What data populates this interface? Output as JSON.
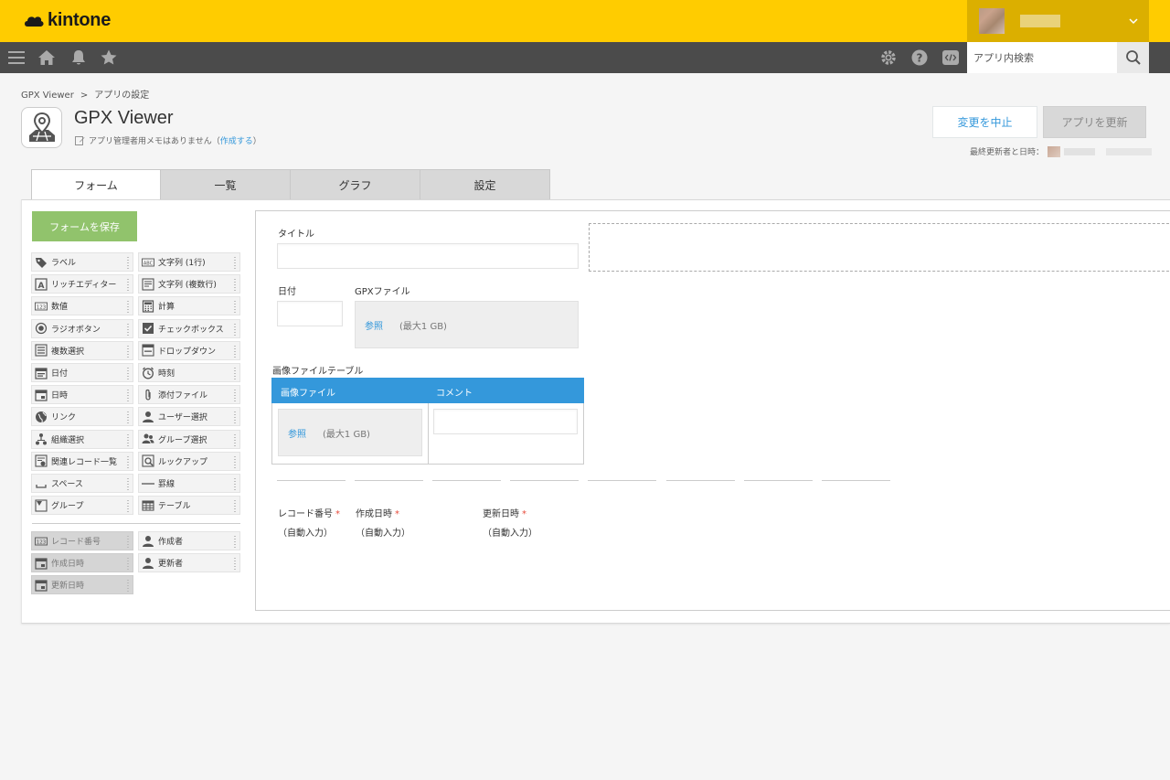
{
  "header": {
    "brand": "kintone",
    "search_placeholder": "アプリ内検索"
  },
  "breadcrumb": {
    "items": [
      "GPX Viewer",
      "アプリの設定"
    ],
    "separator": ">"
  },
  "app": {
    "title": "GPX Viewer",
    "memo_text": "アプリ管理者用メモはありません",
    "memo_paren_open": "（",
    "memo_link": "作成する",
    "memo_paren_close": "）"
  },
  "actions": {
    "cancel_label": "変更を中止",
    "update_label": "アプリを更新",
    "last_updated_label": "最終更新者と日時："
  },
  "tabs": [
    "フォーム",
    "一覧",
    "グラフ",
    "設定"
  ],
  "palette": {
    "save_label": "フォームを保存",
    "left": [
      {
        "label": "ラベル",
        "icon": "tag-icon"
      },
      {
        "label": "リッチエディター",
        "icon": "rich-editor-icon"
      },
      {
        "label": "数値",
        "icon": "number-icon"
      },
      {
        "label": "ラジオボタン",
        "icon": "radio-icon"
      },
      {
        "label": "複数選択",
        "icon": "multi-select-icon"
      },
      {
        "label": "日付",
        "icon": "calendar-icon"
      },
      {
        "label": "日時",
        "icon": "datetime-icon"
      },
      {
        "label": "リンク",
        "icon": "globe-icon"
      },
      {
        "label": "組織選択",
        "icon": "org-icon"
      },
      {
        "label": "関連レコード一覧",
        "icon": "related-records-icon"
      },
      {
        "label": "スペース",
        "icon": "space-icon"
      },
      {
        "label": "グループ",
        "icon": "group-icon"
      }
    ],
    "right": [
      {
        "label": "文字列 (1行)",
        "icon": "text-single-icon"
      },
      {
        "label": "文字列 (複数行)",
        "icon": "text-multi-icon"
      },
      {
        "label": "計算",
        "icon": "calculator-icon"
      },
      {
        "label": "チェックボックス",
        "icon": "checkbox-icon"
      },
      {
        "label": "ドロップダウン",
        "icon": "dropdown-icon"
      },
      {
        "label": "時刻",
        "icon": "clock-icon"
      },
      {
        "label": "添付ファイル",
        "icon": "paperclip-icon"
      },
      {
        "label": "ユーザー選択",
        "icon": "user-icon"
      },
      {
        "label": "グループ選択",
        "icon": "users-icon"
      },
      {
        "label": "ルックアップ",
        "icon": "lookup-icon"
      },
      {
        "label": "罫線",
        "icon": "line-icon"
      },
      {
        "label": "テーブル",
        "icon": "table-icon"
      }
    ],
    "system_left": [
      {
        "label": "レコード番号",
        "icon": "number-icon"
      },
      {
        "label": "作成日時",
        "icon": "datetime-icon"
      },
      {
        "label": "更新日時",
        "icon": "datetime-icon"
      }
    ],
    "system_right": [
      {
        "label": "作成者",
        "icon": "user-icon"
      },
      {
        "label": "更新者",
        "icon": "user-icon"
      }
    ]
  },
  "form": {
    "title_label": "タイトル",
    "date_label": "日付",
    "gpx_label": "GPXファイル",
    "gpx_browse": "参照",
    "gpx_limit": "(最大1 GB)",
    "table_label": "画像ファイルテーブル",
    "table_col1": "画像ファイル",
    "table_col2": "コメント",
    "table_browse": "参照",
    "table_limit": "(最大1 GB)",
    "record_no_label": "レコード番号",
    "created_label": "作成日時",
    "updated_label": "更新日時",
    "required_mark": "*",
    "auto_value": "（自動入力）"
  },
  "colors": {
    "brand_yellow": "#ffcc00",
    "toolbar": "#4b4b4b",
    "accent_blue": "#3498db",
    "save_green": "#91c36c"
  }
}
